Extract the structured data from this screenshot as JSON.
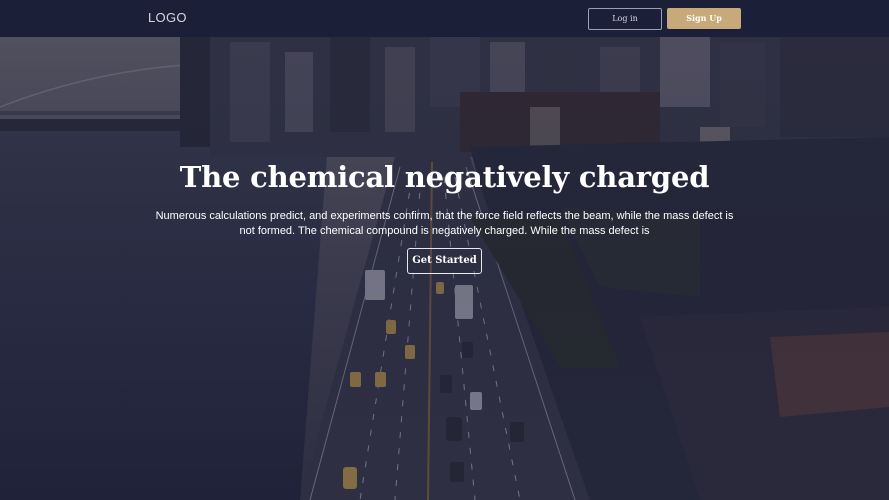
{
  "header": {
    "logo": "LOGO",
    "login_label": "Log in",
    "signup_label": "Sign Up"
  },
  "hero": {
    "title": "The chemical negatively charged",
    "subtitle": "Numerous calculations predict, and experiments confirm, that the force field reflects the beam, while the mass defect is not formed. The chemical compound is negatively charged. While the mass defect is",
    "cta_label": "Get Started",
    "background_image": "aerial-city-highway-photo"
  },
  "colors": {
    "header_bg": "#1b1f38",
    "accent": "#c7a97a",
    "overlay": "#1c1f3a",
    "text": "#ffffff"
  }
}
